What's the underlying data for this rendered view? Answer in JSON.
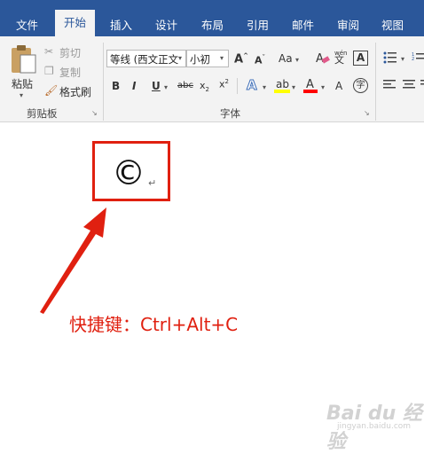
{
  "tabs": [
    "文件",
    "开始",
    "插入",
    "设计",
    "布局",
    "引用",
    "邮件",
    "审阅",
    "视图"
  ],
  "active_tab_index": 1,
  "clipboard": {
    "paste": "粘贴",
    "cut": "剪切",
    "copy": "复制",
    "format_painter": "格式刷",
    "group_label": "剪贴板"
  },
  "font": {
    "font_name": "等线 (西文正文",
    "font_size": "小初",
    "group_label": "字体",
    "wen_label": "wén",
    "wen_char": "文",
    "enclose_char": "字"
  },
  "document": {
    "symbol": "©",
    "paragraph_mark": "↵",
    "caption": "快捷键：Ctrl+Alt+C"
  },
  "watermark": {
    "text": "Bai du 经验",
    "url": "jingyan.baidu.com"
  },
  "colors": {
    "ribbon_blue": "#2b579a",
    "annotation_red": "#e02010",
    "highlight_yellow": "#ffff00",
    "font_red": "#ff0000"
  }
}
